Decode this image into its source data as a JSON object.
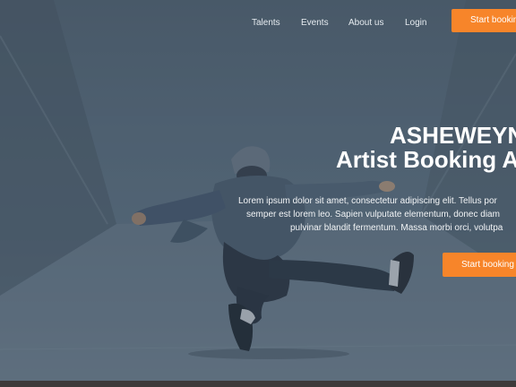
{
  "nav": {
    "links": [
      "Talents",
      "Events",
      "About us",
      "Login"
    ],
    "cta_label": "Start booking"
  },
  "hero": {
    "title_line1": "ASHEWEYN",
    "title_line2": "Artist Booking Ap",
    "description_lines": [
      "Lorem ipsum dolor sit amet, consectetur adipiscing elit. Tellus por",
      "semper est lorem leo. Sapien vulputate elementum, donec diam",
      "pulvinar blandit fermentum. Massa morbi orci, volutpa"
    ],
    "cta_label": "Start booking",
    "image": "dancer-photo"
  },
  "colors": {
    "accent": "#f7852a",
    "overlay": "#2b3a4a",
    "text": "#ffffff"
  }
}
